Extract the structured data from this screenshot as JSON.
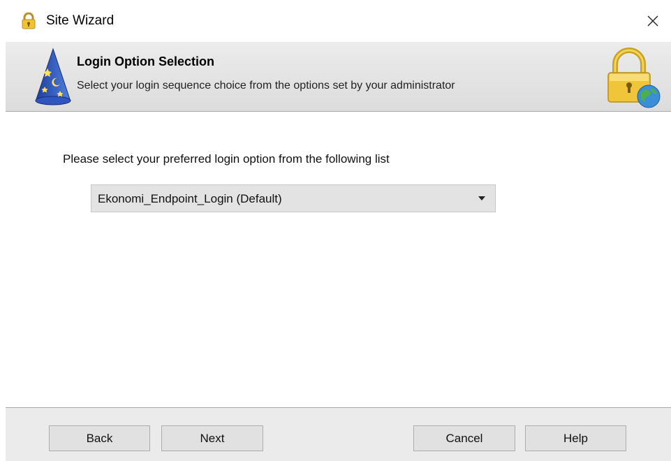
{
  "window": {
    "title": "Site Wizard",
    "close_icon": "close-icon"
  },
  "header": {
    "title": "Login Option Selection",
    "subtitle": "Select your login sequence choice from the options set by your administrator",
    "left_icon": "wizard-hat-icon",
    "right_icon": "padlock-globe-icon"
  },
  "main": {
    "prompt": "Please select your preferred  login option from the following list",
    "login_option": {
      "selected": "Ekonomi_Endpoint_Login  (Default)",
      "icon": "chevron-down-icon"
    }
  },
  "footer": {
    "back_label": "Back",
    "next_label": "Next",
    "cancel_label": "Cancel",
    "help_label": "Help"
  },
  "colors": {
    "header_bg": "#e2e2e2",
    "footer_bg": "#ebebeb",
    "button_bg": "#e1e1e1",
    "select_bg": "#e3e3e3"
  }
}
